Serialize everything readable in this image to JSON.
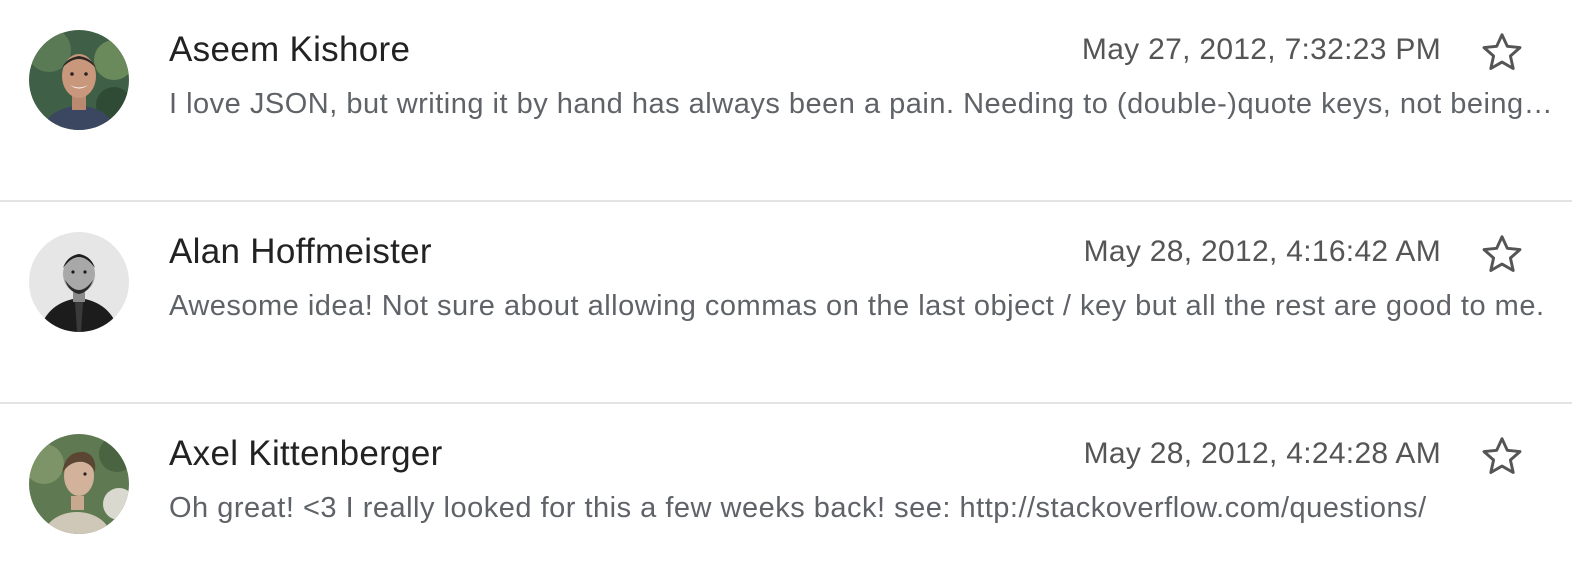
{
  "messages": [
    {
      "sender": "Aseem Kishore",
      "timestamp": "May 27, 2012, 7:32:23 PM",
      "snippet": "I love JSON, but writing it by hand has always been a pain. Needing to (double-)quote keys, not being able to have comments, and trailing commas not being allowed are all annoyances.",
      "starred": false,
      "avatar_icon": "person-photo-icon",
      "star_icon": "star-outline-icon"
    },
    {
      "sender": "Alan Hoffmeister",
      "timestamp": "May 28, 2012, 4:16:42 AM",
      "snippet": "Awesome idea! Not sure about allowing commas on the last object / key but all the rest are good to me.",
      "starred": false,
      "avatar_icon": "person-photo-icon",
      "star_icon": "star-outline-icon"
    },
    {
      "sender": "Axel Kittenberger",
      "timestamp": "May 28, 2012, 4:24:28 AM",
      "snippet": "Oh great! <3 I really looked for this a few weeks back! see: http://stackoverflow.com/questions/",
      "starred": false,
      "avatar_icon": "person-photo-icon",
      "star_icon": "star-outline-icon"
    }
  ],
  "colors": {
    "sender": "#222222",
    "timestamp": "#555555",
    "snippet": "#5f6368",
    "divider": "#e3e3e3",
    "star_outline": "#555555"
  }
}
